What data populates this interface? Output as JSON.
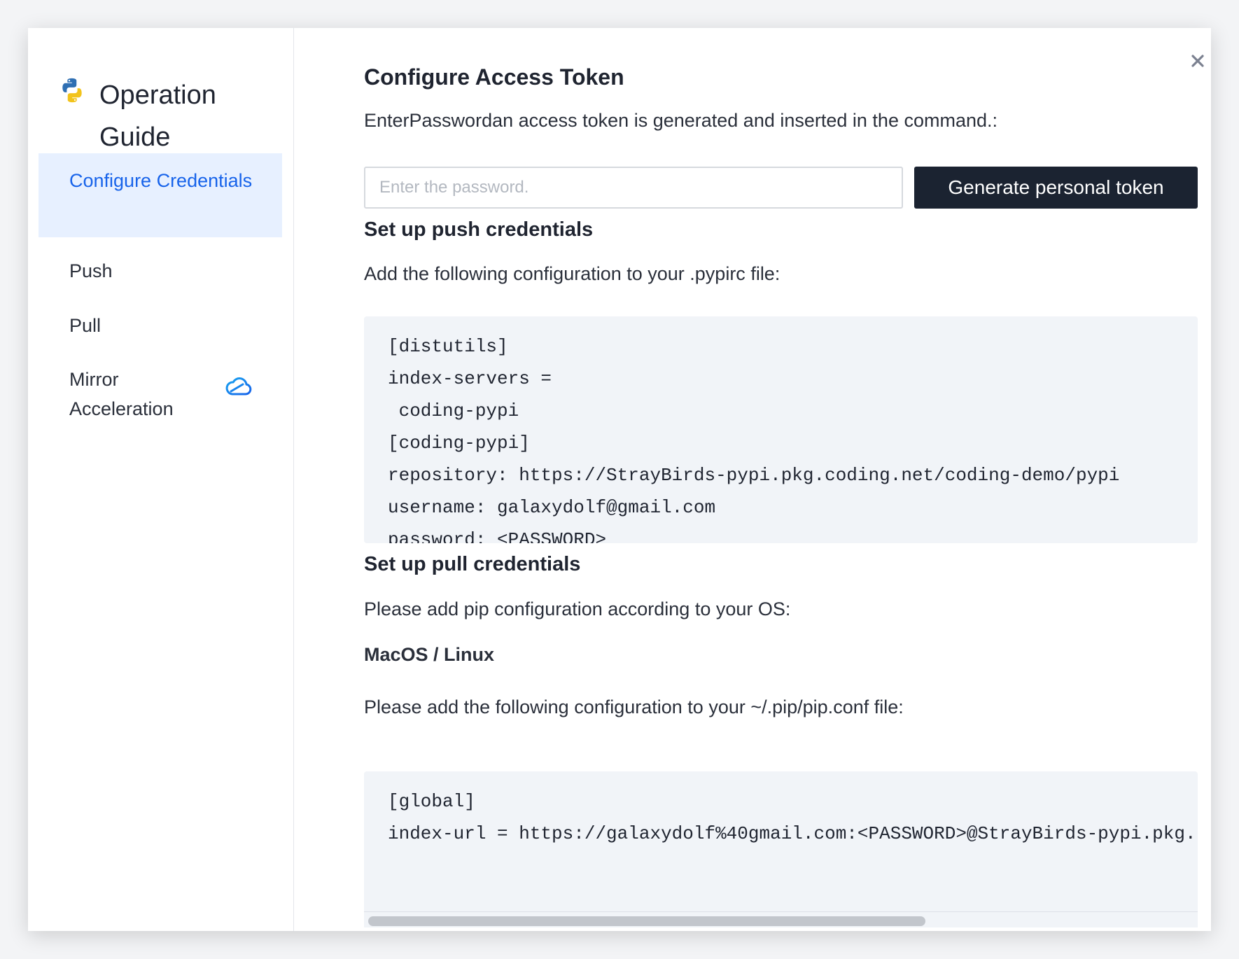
{
  "sidebar": {
    "title": "Operation Guide",
    "items": [
      {
        "label": "Configure Credentials",
        "active": true
      },
      {
        "label": "Push",
        "active": false
      },
      {
        "label": "Pull",
        "active": false
      },
      {
        "label": "Mirror Acceleration",
        "active": false,
        "badge_icon": "cloud-icon"
      }
    ]
  },
  "content": {
    "token_section": {
      "heading": "Configure Access Token",
      "description": "EnterPasswordan access token is generated and inserted in the command.:",
      "password_placeholder": "Enter the password.",
      "password_value": "",
      "generate_button": "Generate personal token"
    },
    "push_section": {
      "heading": "Set up push credentials",
      "description": "Add the following configuration to your .pypirc file:",
      "code_lines": [
        "[distutils]",
        "index-servers =",
        " coding-pypi",
        "[coding-pypi]",
        "repository: https://StrayBirds-pypi.pkg.coding.net/coding-demo/pypi",
        "username: galaxydolf@gmail.com",
        "password: <PASSWORD>"
      ]
    },
    "pull_section": {
      "heading": "Set up pull credentials",
      "description": "Please add pip configuration according to your OS:",
      "os_heading": "MacOS / Linux",
      "os_description": "Please add the following configuration to your ~/.pip/pip.conf file:",
      "code_lines": [
        "[global]",
        "index-url = https://galaxydolf%40gmail.com:<PASSWORD>@StrayBirds-pypi.pkg."
      ]
    }
  },
  "colors": {
    "accent": "#1763ea",
    "active_bg": "#e7f0ff",
    "button_bg": "#1b2331",
    "code_bg": "#f1f4f8"
  },
  "icons": {
    "brand": "python-logo-icon",
    "close": "close-icon",
    "mirror_badge": "cloud-icon"
  }
}
